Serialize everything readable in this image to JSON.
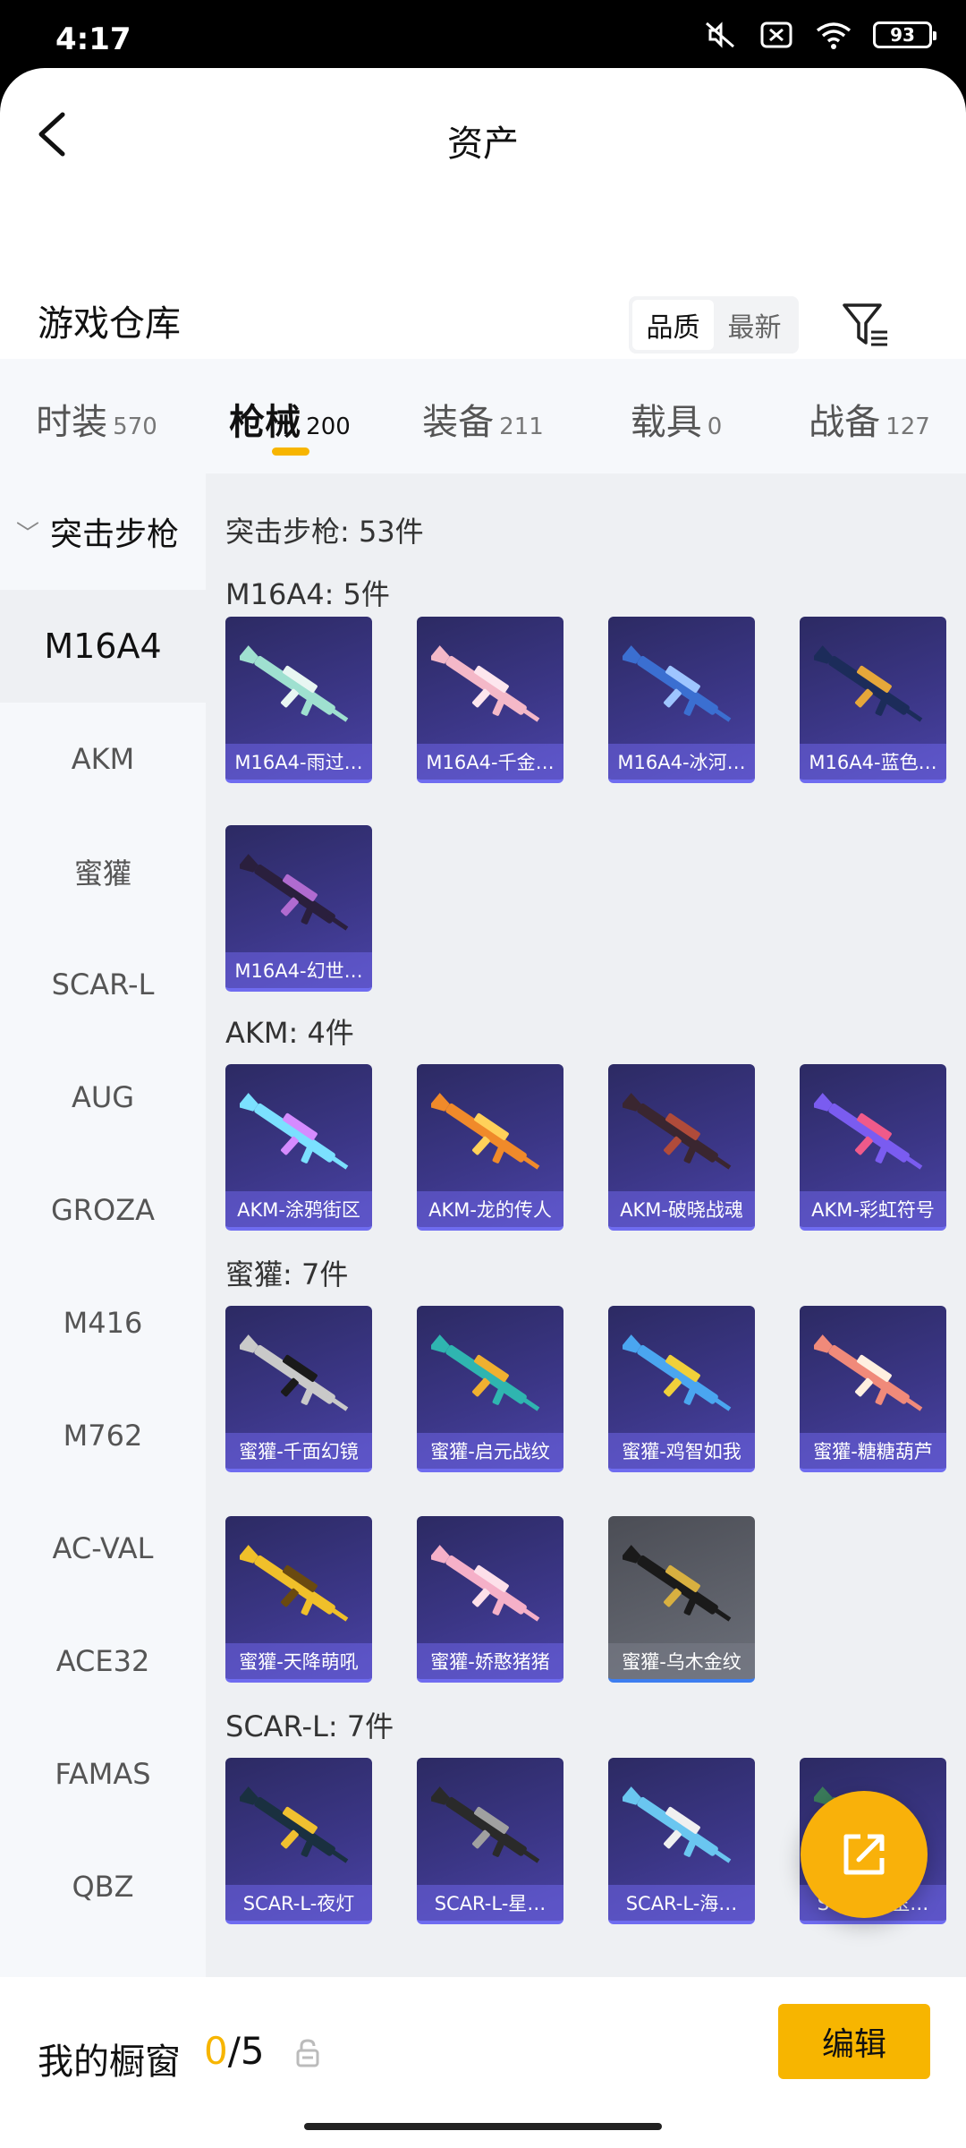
{
  "status_bar": {
    "time": "4:17",
    "battery": "93"
  },
  "header": {
    "title": "资产"
  },
  "warehouse": {
    "title": "游戏仓库",
    "sort_options": [
      "品质",
      "最新"
    ],
    "active_sort": "品质"
  },
  "tabs": [
    {
      "label": "时装",
      "count": "570"
    },
    {
      "label": "枪械",
      "count": "200",
      "active": true
    },
    {
      "label": "装备",
      "count": "211"
    },
    {
      "label": "载具",
      "count": "0"
    },
    {
      "label": "战备",
      "count": "127"
    }
  ],
  "sidebar": {
    "group": "突击步枪",
    "items": [
      "M16A4",
      "AKM",
      "蜜獾",
      "SCAR-L",
      "AUG",
      "GROZA",
      "M416",
      "M762",
      "AC-VAL",
      "ACE32",
      "FAMAS",
      "QBZ"
    ],
    "active": "M16A4"
  },
  "content": {
    "category_summary": "突击步枪: 53件",
    "sections": [
      {
        "title": "M16A4: 5件",
        "items": [
          "M16A4-雨过…",
          "M16A4-千金…",
          "M16A4-冰河…",
          "M16A4-蓝色…",
          "M16A4-幻世…"
        ]
      },
      {
        "title": "AKM: 4件",
        "items": [
          "AKM-涂鸦街区",
          "AKM-龙的传人",
          "AKM-破晓战魂",
          "AKM-彩虹符号"
        ]
      },
      {
        "title": "蜜獾: 7件",
        "items": [
          "蜜獾-千面幻镜",
          "蜜獾-启元战纹",
          "蜜獾-鸡智如我",
          "蜜獾-糖糖葫芦",
          "蜜獾-天降萌吼",
          "蜜獾-娇憨猪猪",
          "蜜獾-乌木金纹"
        ]
      },
      {
        "title": "SCAR-L: 7件",
        "items": [
          "SCAR-L-夜灯",
          "SCAR-L-星…",
          "SCAR-L-海…",
          "SCAR-L-玉…"
        ]
      }
    ]
  },
  "showcase": {
    "label": "我的橱窗",
    "current": "0",
    "separator": "/",
    "total": "5",
    "edit_label": "编辑"
  },
  "colors": {
    "accent": "#f7b500",
    "card_bg": "#3b3686",
    "content_bg": "#eef0f3"
  }
}
